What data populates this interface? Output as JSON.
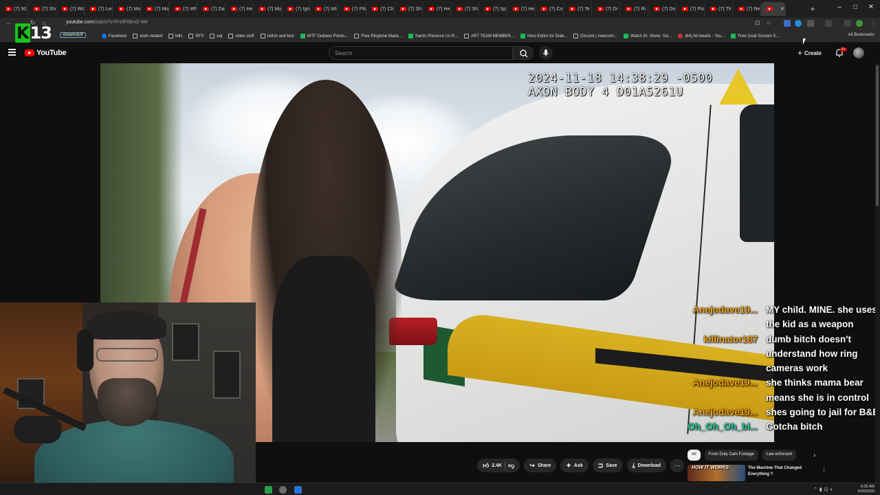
{
  "browser": {
    "tabs": [
      {
        "label": "(7) 50"
      },
      {
        "label": "(7) She"
      },
      {
        "label": "(7) Wo"
      },
      {
        "label": "(7) Les"
      },
      {
        "label": "(7) Mo"
      },
      {
        "label": "(7) Mo"
      },
      {
        "label": "(7) Wh"
      },
      {
        "label": "(7) Da"
      },
      {
        "label": "(7) He"
      },
      {
        "label": "(7) Mo"
      },
      {
        "label": "(7) Ign"
      },
      {
        "label": "(7) Wi"
      },
      {
        "label": "(7) FW"
      },
      {
        "label": "(7) Ch"
      },
      {
        "label": "(7) Sh"
      },
      {
        "label": "(7) He"
      },
      {
        "label": "(7) Sh"
      },
      {
        "label": "(7) Sp"
      },
      {
        "label": "(7) He"
      },
      {
        "label": "(7) Co"
      },
      {
        "label": "(7) Te"
      },
      {
        "label": "(7) Dr"
      },
      {
        "label": "(7) Ri"
      },
      {
        "label": "(7) Do"
      },
      {
        "label": "(7) Flo"
      },
      {
        "label": "(7) Th"
      },
      {
        "label": "(7) Re"
      }
    ],
    "new_tab_label": "+",
    "window_controls": {
      "minimize": "–",
      "maximize": "□",
      "close": "✕"
    },
    "url": {
      "domain": "youtube.com",
      "path": "/watch?v=Fn0P0bmZ-4M"
    },
    "bookmarks": [
      {
        "label": "Facebook",
        "icon": "facebook-icon"
      },
      {
        "label": "work related",
        "icon": "folder-icon"
      },
      {
        "label": "bills",
        "icon": "folder-icon"
      },
      {
        "label": "RFS",
        "icon": "folder-icon"
      },
      {
        "label": "eql",
        "icon": "folder-icon"
      },
      {
        "label": "video stuff",
        "icon": "folder-icon"
      },
      {
        "label": "twitch and kick",
        "icon": "folder-icon"
      },
      {
        "label": "WTF Outlaws Points...",
        "icon": "site-icon"
      },
      {
        "label": "Free Ringtone Make...",
        "icon": "site-icon"
      },
      {
        "label": "Saints Preserve Us R...",
        "icon": "site-icon"
      },
      {
        "label": "ART TEAM MEMBER...",
        "icon": "site-icon"
      },
      {
        "label": "Hero Editor for Diab...",
        "icon": "site-icon"
      },
      {
        "label": "Discord | #welcom...",
        "icon": "discord-icon"
      },
      {
        "label": "Watch Dr. Stone: Sci...",
        "icon": "site-icon"
      },
      {
        "label": "(64) Ali Awads - You...",
        "icon": "youtube-icon"
      },
      {
        "label": "Free Goat Scream S...",
        "icon": "site-icon"
      }
    ],
    "all_bookmarks_label": "All Bookmarks",
    "streamstuff_label": "streamstuff"
  },
  "overlay": {
    "logo_k": "K",
    "logo_num": "13"
  },
  "youtube": {
    "logo_text": "YouTube",
    "search_placeholder": "Search",
    "create_label": "Create",
    "notification_count": "9+",
    "video": {
      "timestamp_line1": "2024-11-18 14:38:29 -0500",
      "timestamp_line2": "AXON BODY 4 D01A5261U"
    },
    "actions": {
      "like_count": "2.4K",
      "share": "Share",
      "ask": "Ask",
      "save": "Save",
      "download": "Download"
    },
    "chips": [
      "All",
      "From Duty Cam Footage",
      "Law enforcem"
    ],
    "recommendation": {
      "thumb_text": "HOW IT WORKS",
      "title": "The Machine That Changed Everything ?"
    }
  },
  "chat": [
    {
      "user": "Anejodave19...",
      "color": "#f5a31a",
      "lines": [
        "MY child. MINE. she uses",
        "the kid as a weapon"
      ]
    },
    {
      "user": "killinator187",
      "color": "#f5a31a",
      "lines": [
        "dumb bitch doesn't",
        "understand how ring",
        "cameras work"
      ]
    },
    {
      "user": "Anejodave19...",
      "color": "#f5a31a",
      "lines": [
        "she thinks mama bear",
        "means she is in control"
      ]
    },
    {
      "user": "Anejodave19...",
      "color": "#f5a31a",
      "lines": [
        "shes going to jail for B&E"
      ]
    },
    {
      "user": "Oh_Oh_Oh_bl...",
      "color": "#25d0a0",
      "lines": [
        "Gotcha bitch"
      ]
    }
  ],
  "taskbar": {
    "time": "8:35 AM",
    "date": "4/20/2026"
  },
  "colors": {
    "accent_red": "#ff0000",
    "bg": "#0f0f0f",
    "chip_active": "#f1f1f1"
  }
}
